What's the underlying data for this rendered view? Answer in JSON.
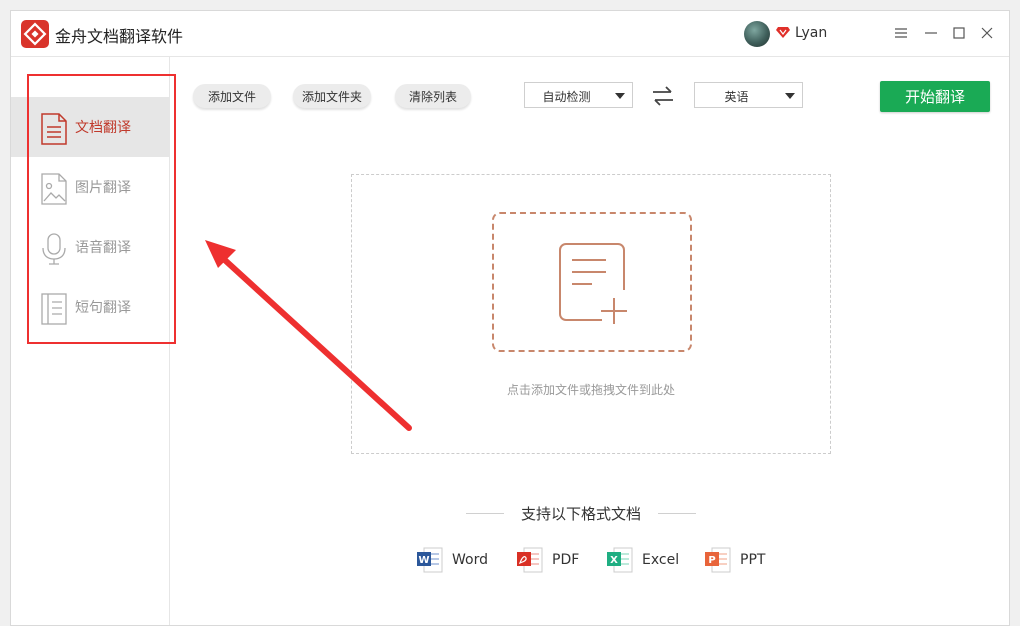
{
  "app": {
    "title": "金舟文档翻译软件"
  },
  "user": {
    "name": "Lyan"
  },
  "sidebar": {
    "items": [
      {
        "label": "文档翻译",
        "active": true,
        "icon": "document-icon"
      },
      {
        "label": "图片翻译",
        "active": false,
        "icon": "image-icon"
      },
      {
        "label": "语音翻译",
        "active": false,
        "icon": "microphone-icon"
      },
      {
        "label": "短句翻译",
        "active": false,
        "icon": "sentence-icon"
      }
    ]
  },
  "toolbar": {
    "add_file": "添加文件",
    "add_folder": "添加文件夹",
    "clear_list": "清除列表",
    "source_lang": "自动检测",
    "target_lang": "英语",
    "start": "开始翻译"
  },
  "dropzone": {
    "hint": "点击添加文件或拖拽文件到此处"
  },
  "formats": {
    "title": "支持以下格式文档",
    "items": [
      {
        "label": "Word",
        "color": "#2b579a"
      },
      {
        "label": "PDF",
        "color": "#d93025"
      },
      {
        "label": "Excel",
        "color": "#1fae82"
      },
      {
        "label": "PPT",
        "color": "#e8643a"
      }
    ]
  },
  "colors": {
    "accent_green": "#1aaa55",
    "active_red": "#c0392b",
    "annotation_red": "#ee3030"
  }
}
